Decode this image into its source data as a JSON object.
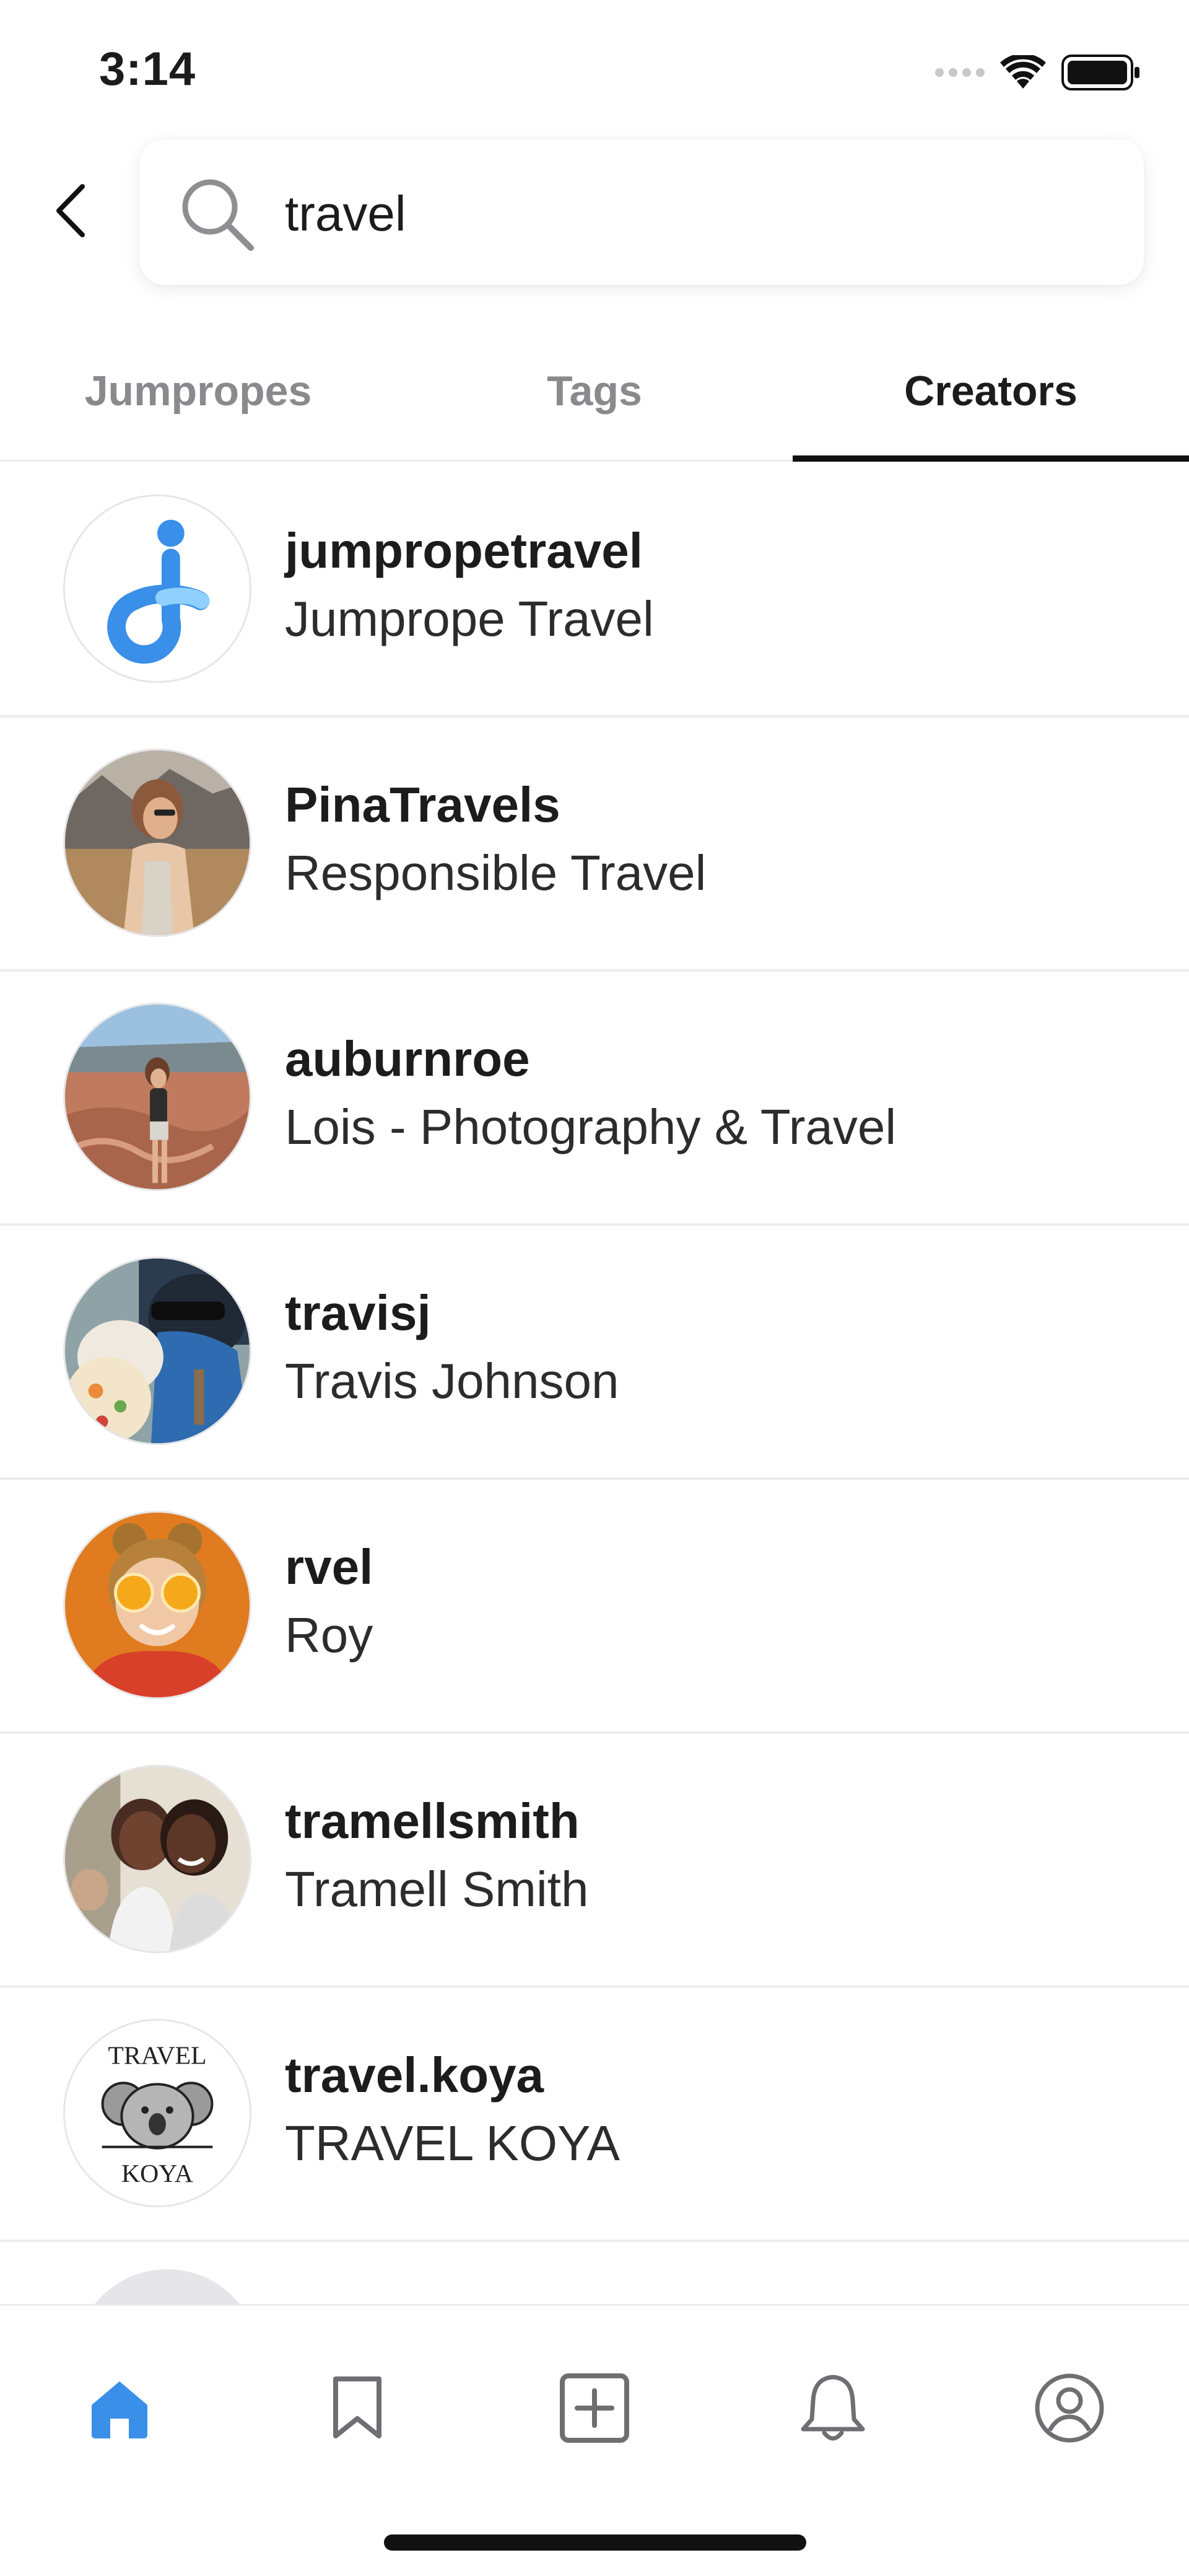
{
  "status_bar": {
    "time": "3:14"
  },
  "search": {
    "value": "travel",
    "placeholder": ""
  },
  "tabs": [
    {
      "label": "Jumpropes",
      "active": false
    },
    {
      "label": "Tags",
      "active": false
    },
    {
      "label": "Creators",
      "active": true
    }
  ],
  "creators": [
    {
      "username": "jumpropetravel",
      "name": "Jumprope Travel",
      "avatar": "jumprope-logo"
    },
    {
      "username": "PinaTravels",
      "name": "Responsible Travel",
      "avatar": "photo-desert-portrait"
    },
    {
      "username": "auburnroe",
      "name": "Lois - Photography & Travel",
      "avatar": "photo-canyon"
    },
    {
      "username": "travisj",
      "name": "Travis Johnson",
      "avatar": "photo-family"
    },
    {
      "username": "rvel",
      "name": "Roy",
      "avatar": "photo-orange-slices"
    },
    {
      "username": "tramellsmith",
      "name": "Tramell Smith",
      "avatar": "photo-couple"
    },
    {
      "username": "travel.koya",
      "name": "TRAVEL KOYA",
      "avatar": "koala-logo",
      "avatar_text": [
        "TRAVEL",
        "KOYA"
      ]
    }
  ],
  "bottom_nav": [
    {
      "icon": "home-icon",
      "active": true
    },
    {
      "icon": "bookmark-icon",
      "active": false
    },
    {
      "icon": "add-icon",
      "active": false
    },
    {
      "icon": "bell-icon",
      "active": false
    },
    {
      "icon": "profile-icon",
      "active": false
    }
  ],
  "colors": {
    "accent": "#3a8fe8",
    "text": "#1c1c1e",
    "muted": "#8a8a8e",
    "divider": "#ececee"
  }
}
